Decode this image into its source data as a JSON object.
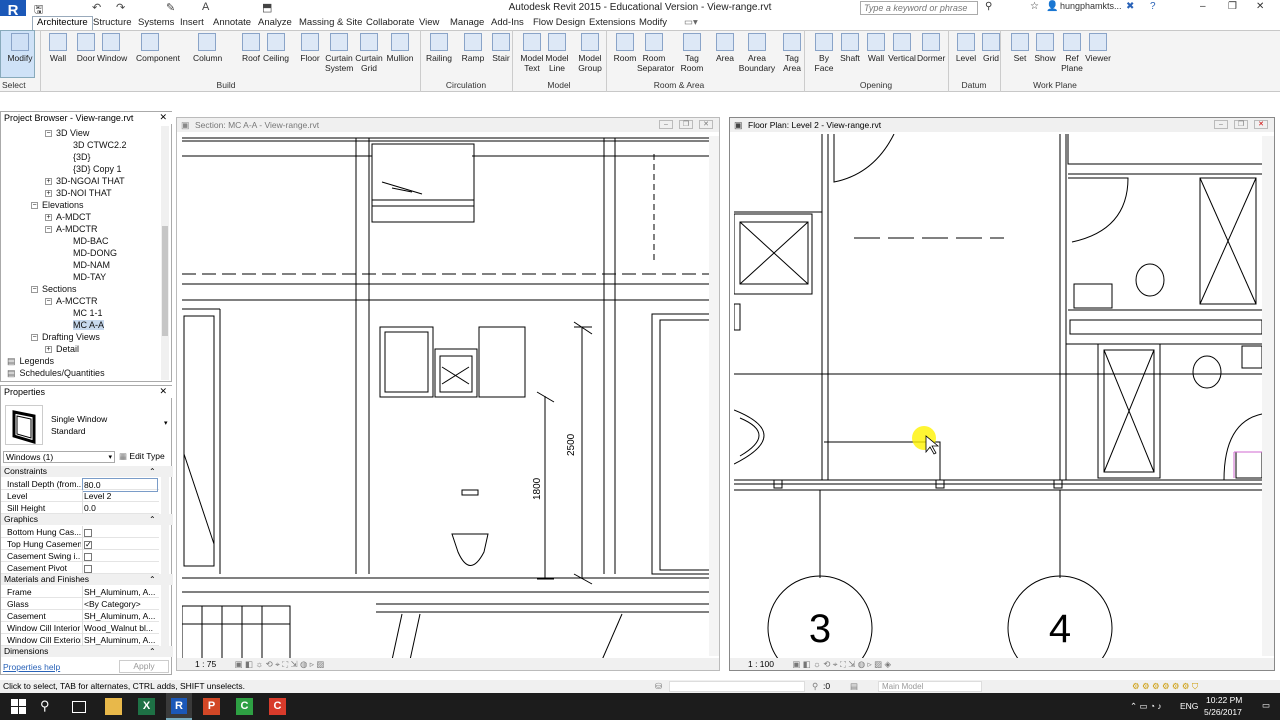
{
  "window": {
    "title": "Autodesk Revit 2015 - Educational Version -    View-range.rvt",
    "app_letter": "R"
  },
  "qat_glyphs": [
    "🖫",
    "↶",
    "↷",
    "▾",
    "✎",
    "A",
    "⬒"
  ],
  "search": {
    "placeholder": "Type a keyword or phrase",
    "user": "hungphamkts..."
  },
  "tabs": [
    "Architecture",
    "Structure",
    "Systems",
    "Insert",
    "Annotate",
    "Analyze",
    "Massing & Site",
    "Collaborate",
    "View",
    "Manage",
    "Add-Ins",
    "Flow Design",
    "Extensions",
    "Modify"
  ],
  "ribbon": {
    "buttons": [
      {
        "label": "Modify",
        "icon": "cursor-icon"
      },
      {
        "label": "Wall",
        "icon": "wall-icon"
      },
      {
        "label": "Door",
        "icon": "door-icon"
      },
      {
        "label": "Window",
        "icon": "window-icon"
      },
      {
        "label": "Component",
        "icon": "component-icon"
      },
      {
        "label": "Column",
        "icon": "column-icon"
      },
      {
        "label": "Roof",
        "icon": "roof-icon"
      },
      {
        "label": "Ceiling",
        "icon": "ceiling-icon"
      },
      {
        "label": "Floor",
        "icon": "floor-icon"
      },
      {
        "label": "Curtain\nSystem",
        "icon": "curtain-system-icon"
      },
      {
        "label": "Curtain\nGrid",
        "icon": "curtain-grid-icon"
      },
      {
        "label": "Mullion",
        "icon": "mullion-icon"
      },
      {
        "label": "Railing",
        "icon": "railing-icon"
      },
      {
        "label": "Ramp",
        "icon": "ramp-icon"
      },
      {
        "label": "Stair",
        "icon": "stair-icon"
      },
      {
        "label": "Model\nText",
        "icon": "model-text-icon"
      },
      {
        "label": "Model\nLine",
        "icon": "model-line-icon"
      },
      {
        "label": "Model\nGroup",
        "icon": "model-group-icon"
      },
      {
        "label": "Room",
        "icon": "room-icon"
      },
      {
        "label": "Room\nSeparator",
        "icon": "room-separator-icon"
      },
      {
        "label": "Tag\nRoom",
        "icon": "tag-room-icon"
      },
      {
        "label": "Area",
        "icon": "area-icon"
      },
      {
        "label": "Area\nBoundary",
        "icon": "area-boundary-icon"
      },
      {
        "label": "Tag\nArea",
        "icon": "tag-area-icon"
      },
      {
        "label": "By\nFace",
        "icon": "by-face-icon"
      },
      {
        "label": "Shaft",
        "icon": "shaft-icon"
      },
      {
        "label": "Wall",
        "icon": "opening-wall-icon"
      },
      {
        "label": "Vertical",
        "icon": "vertical-icon"
      },
      {
        "label": "Dormer",
        "icon": "dormer-icon"
      },
      {
        "label": "Level",
        "icon": "level-icon"
      },
      {
        "label": "Grid",
        "icon": "grid-icon"
      },
      {
        "label": "Set",
        "icon": "set-icon"
      },
      {
        "label": "Show",
        "icon": "show-icon"
      },
      {
        "label": "Ref\nPlane",
        "icon": "ref-plane-icon"
      },
      {
        "label": "Viewer",
        "icon": "viewer-icon"
      }
    ],
    "panels": [
      "Select",
      "Build",
      "Circulation",
      "Model",
      "Room & Area",
      "Opening",
      "Datum",
      "Work Plane"
    ]
  },
  "project_browser": {
    "title": "Project Browser - View-range.rvt",
    "items": [
      {
        "text": "3D View",
        "level": 3,
        "exp": "−"
      },
      {
        "text": "3D CTWC2.2",
        "level": 5,
        "exp": ""
      },
      {
        "text": "{3D}",
        "level": 5,
        "exp": ""
      },
      {
        "text": "{3D} Copy 1",
        "level": 5,
        "exp": ""
      },
      {
        "text": "3D-NGOAI THAT",
        "level": 3,
        "exp": "+"
      },
      {
        "text": "3D-NOI THAT",
        "level": 3,
        "exp": "+"
      },
      {
        "text": "Elevations",
        "level": 2,
        "exp": "−"
      },
      {
        "text": "A-MDCT",
        "level": 3,
        "exp": "+"
      },
      {
        "text": "A-MDCTR",
        "level": 3,
        "exp": "−"
      },
      {
        "text": "MD-BAC",
        "level": 5,
        "exp": ""
      },
      {
        "text": "MD-DONG",
        "level": 5,
        "exp": ""
      },
      {
        "text": "MD-NAM",
        "level": 5,
        "exp": ""
      },
      {
        "text": "MD-TAY",
        "level": 5,
        "exp": ""
      },
      {
        "text": "Sections",
        "level": 2,
        "exp": "−"
      },
      {
        "text": "A-MCCTR",
        "level": 3,
        "exp": "−"
      },
      {
        "text": "MC 1-1",
        "level": 5,
        "exp": ""
      },
      {
        "text": "MC A-A",
        "level": 5,
        "exp": "",
        "selected": true
      },
      {
        "text": "Drafting Views",
        "level": 2,
        "exp": "−"
      },
      {
        "text": "Detail",
        "level": 3,
        "exp": "+"
      },
      {
        "text": "Legends",
        "level": 1,
        "exp": "▤"
      },
      {
        "text": "Schedules/Quantities",
        "level": 1,
        "exp": "▤"
      }
    ]
  },
  "properties": {
    "title": "Properties",
    "type_name": "Single Window",
    "type_sub": "Standard",
    "selector": "Windows (1)",
    "edit_type": "Edit Type",
    "groups": [
      {
        "name": "Constraints",
        "rows": [
          {
            "k": "Install Depth (from...",
            "v": "80.0"
          },
          {
            "k": "Level",
            "v": "Level 2"
          },
          {
            "k": "Sill Height",
            "v": "0.0"
          }
        ]
      },
      {
        "name": "Graphics",
        "rows": [
          {
            "k": "Bottom Hung Cas...",
            "v": "",
            "check": false
          },
          {
            "k": "Top Hung Casement",
            "v": "",
            "check": true
          },
          {
            "k": "Casement Swing i...",
            "v": "",
            "check": false
          },
          {
            "k": "Casement Pivot",
            "v": "",
            "check": false
          }
        ]
      },
      {
        "name": "Materials and Finishes",
        "rows": [
          {
            "k": "Frame",
            "v": "SH_Aluminum, A..."
          },
          {
            "k": "Glass",
            "v": "<By Category>"
          },
          {
            "k": "Casement",
            "v": "SH_Aluminum, A..."
          },
          {
            "k": "Window Cill Interior",
            "v": "Wood_Walnut bl..."
          },
          {
            "k": "Window Cill Exterior",
            "v": "SH_Aluminum, A..."
          }
        ]
      },
      {
        "name": "Dimensions",
        "rows": []
      }
    ],
    "help": "Properties help",
    "apply": "Apply"
  },
  "views": {
    "section": {
      "title": "Section: MC A-A - View-range.rvt",
      "scale": "1 : 75",
      "dim_a": "2500",
      "dim_b": "1800"
    },
    "plan": {
      "title": "Floor Plan: Level 2 - View-range.rvt",
      "scale": "1 : 100",
      "grid_a": "3",
      "grid_b": "4"
    }
  },
  "status": {
    "text": "Click to select, TAB for alternates, CTRL adds, SHIFT unselects.",
    "model": "Main Model",
    "count": ":0"
  },
  "taskbar": {
    "lang": "ENG",
    "time": "10:22 PM",
    "date": "5/26/2017"
  }
}
